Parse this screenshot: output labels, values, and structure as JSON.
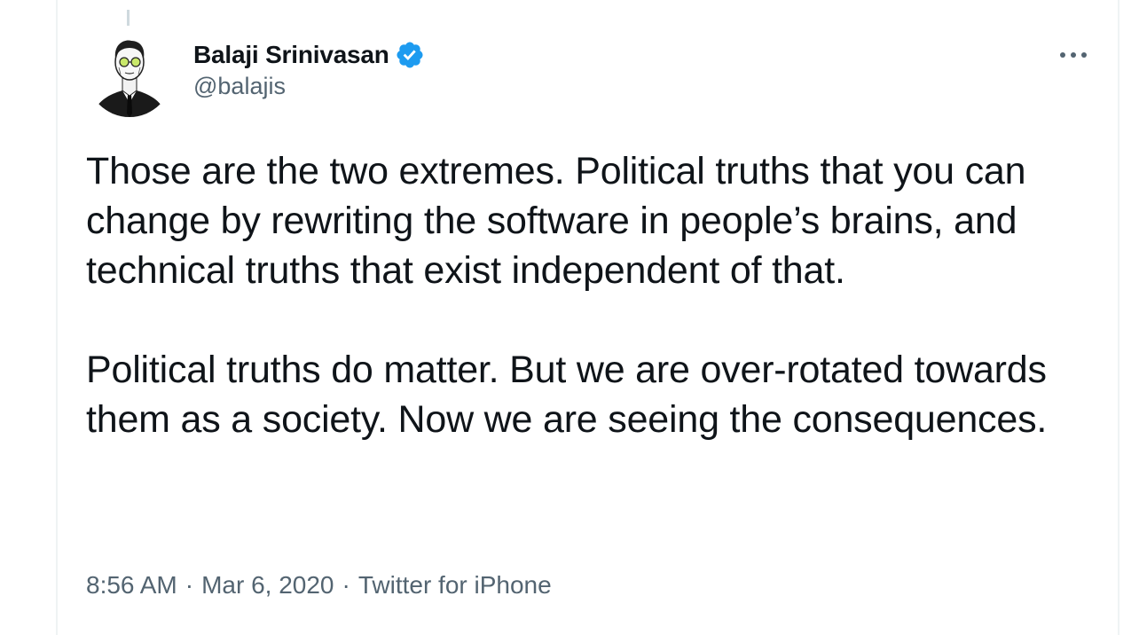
{
  "tweet": {
    "author": {
      "display_name": "Balaji Srinivasan",
      "handle": "@balajis",
      "verified": true,
      "verified_icon": "verified-badge-icon",
      "verified_color": "#1d9bf0"
    },
    "text": "Those are the two extremes. Political truths that you can change by rewriting the software in people’s brains, and technical truths that exist independent of that.\n\nPolitical truths do matter. But we are over-rotated towards them as a society. Now we are seeing the consequences.",
    "meta": {
      "time": "8:56 AM",
      "separator": "·",
      "date": "Mar 6, 2020",
      "source": "Twitter for iPhone"
    },
    "more_icon": "more-horizontal-icon"
  },
  "colors": {
    "text_primary": "#0f1419",
    "text_secondary": "#536471",
    "border": "#eff3f4",
    "accent": "#1d9bf0"
  }
}
